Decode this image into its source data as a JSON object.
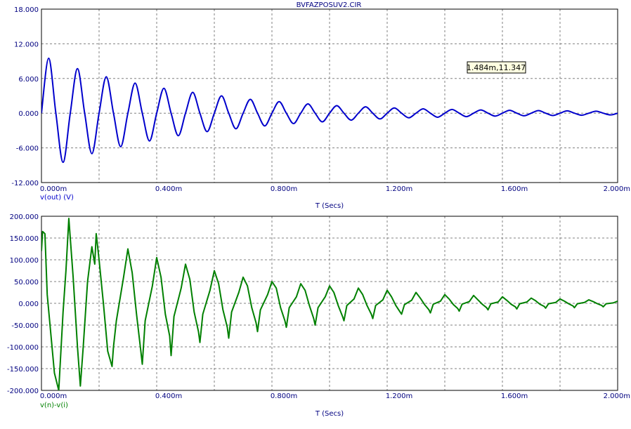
{
  "window": {
    "title": "BVFAZPOSUV2.CIR"
  },
  "colors": {
    "grid": "#808080",
    "frame": "#000000",
    "tick_text": "#000080",
    "top_trace": "#0000cc",
    "bottom_trace": "#008000",
    "tooltip_bg": "#ffffe1"
  },
  "tooltip": {
    "text": "1.484m,11.347",
    "x": 1.484,
    "y": 11.347
  },
  "chart_data": [
    {
      "type": "line",
      "trace_label": "v(out) (V)",
      "xlabel": "T (Secs)",
      "x_ticks": [
        "0.000m",
        "0.400m",
        "0.800m",
        "1.200m",
        "1.600m",
        "2.000m"
      ],
      "y_ticks": [
        "18.000",
        "12.000",
        "6.000",
        "0.000",
        "-6.000",
        "-12.000"
      ],
      "xlim": [
        0,
        2.0
      ],
      "ylim": [
        -12,
        18
      ],
      "series": [
        {
          "label": "v(out) (V)",
          "color": "#0000cc",
          "x": [
            0.0,
            0.025,
            0.05,
            0.075,
            0.1,
            0.125,
            0.15,
            0.175,
            0.2,
            0.225,
            0.25,
            0.275,
            0.3,
            0.325,
            0.35,
            0.375,
            0.4,
            0.425,
            0.45,
            0.475,
            0.5,
            0.525,
            0.55,
            0.575,
            0.6,
            0.625,
            0.65,
            0.675,
            0.7,
            0.725,
            0.75,
            0.775,
            0.8,
            0.825,
            0.85,
            0.875,
            0.9,
            0.925,
            0.95,
            0.975,
            1.0,
            1.025,
            1.05,
            1.075,
            1.1,
            1.125,
            1.15,
            1.175,
            1.2,
            1.225,
            1.25,
            1.275,
            1.3,
            1.325,
            1.35,
            1.375,
            1.4,
            1.425,
            1.45,
            1.475,
            1.5,
            1.525,
            1.55,
            1.575,
            1.6,
            1.625,
            1.65,
            1.675,
            1.7,
            1.725,
            1.75,
            1.775,
            1.8,
            1.825,
            1.85,
            1.875,
            1.9,
            1.925,
            1.95,
            1.975,
            2.0
          ],
          "y": [
            0.0,
            9.5,
            0.0,
            -8.5,
            0.0,
            7.7,
            0.0,
            -7.0,
            0.0,
            6.3,
            0.0,
            -5.8,
            0.0,
            5.2,
            0.0,
            -4.8,
            0.0,
            4.3,
            0.0,
            -3.9,
            0.0,
            3.6,
            0.0,
            -3.2,
            0.0,
            3.0,
            0.0,
            -2.7,
            0.0,
            2.4,
            0.0,
            -2.2,
            0.0,
            2.0,
            0.0,
            -1.8,
            0.0,
            1.6,
            0.0,
            -1.5,
            0.0,
            1.3,
            0.0,
            -1.2,
            0.0,
            1.1,
            0.0,
            -1.0,
            0.0,
            0.9,
            0.0,
            -0.8,
            0.0,
            0.75,
            0.0,
            -0.7,
            0.0,
            0.65,
            0.0,
            -0.6,
            0.0,
            0.55,
            0.0,
            -0.5,
            0.0,
            0.5,
            0.0,
            -0.45,
            0.0,
            0.45,
            0.0,
            -0.4,
            0.0,
            0.4,
            0.0,
            -0.35,
            0.0,
            0.35,
            0.0,
            -0.3,
            0.0
          ]
        }
      ]
    },
    {
      "type": "line",
      "trace_label": "v(n)-v(i)",
      "xlabel": "T (Secs)",
      "x_ticks": [
        "0.000m",
        "0.400m",
        "0.800m",
        "1.200m",
        "1.600m",
        "2.000m"
      ],
      "y_ticks": [
        "200.000",
        "150.000",
        "100.000",
        "50.000",
        "0.000",
        "-50.000",
        "-100.000",
        "-150.000",
        "-200.000"
      ],
      "xlim": [
        0,
        2.0
      ],
      "ylim": [
        -200,
        200
      ],
      "series": [
        {
          "label": "v(n)-v(i)",
          "color": "#008000",
          "x": [
            0.0,
            0.004,
            0.012,
            0.02,
            0.045,
            0.06,
            0.075,
            0.085,
            0.095,
            0.11,
            0.125,
            0.135,
            0.145,
            0.16,
            0.175,
            0.185,
            0.19,
            0.2,
            0.215,
            0.23,
            0.245,
            0.25,
            0.26,
            0.285,
            0.3,
            0.315,
            0.33,
            0.345,
            0.35,
            0.36,
            0.385,
            0.4,
            0.415,
            0.43,
            0.445,
            0.45,
            0.46,
            0.485,
            0.5,
            0.515,
            0.53,
            0.545,
            0.55,
            0.56,
            0.585,
            0.6,
            0.615,
            0.63,
            0.645,
            0.65,
            0.66,
            0.685,
            0.7,
            0.715,
            0.73,
            0.745,
            0.75,
            0.76,
            0.785,
            0.8,
            0.815,
            0.83,
            0.845,
            0.85,
            0.86,
            0.885,
            0.9,
            0.915,
            0.93,
            0.945,
            0.95,
            0.96,
            0.985,
            1.0,
            1.015,
            1.03,
            1.045,
            1.05,
            1.06,
            1.085,
            1.1,
            1.115,
            1.13,
            1.145,
            1.15,
            1.16,
            1.185,
            1.2,
            1.215,
            1.23,
            1.245,
            1.25,
            1.26,
            1.285,
            1.3,
            1.315,
            1.33,
            1.345,
            1.35,
            1.36,
            1.385,
            1.4,
            1.415,
            1.43,
            1.445,
            1.45,
            1.46,
            1.485,
            1.5,
            1.515,
            1.53,
            1.545,
            1.55,
            1.56,
            1.585,
            1.6,
            1.615,
            1.63,
            1.645,
            1.65,
            1.66,
            1.685,
            1.7,
            1.715,
            1.73,
            1.745,
            1.75,
            1.76,
            1.785,
            1.8,
            1.815,
            1.83,
            1.845,
            1.85,
            1.86,
            1.885,
            1.9,
            1.915,
            1.93,
            1.945,
            1.95,
            1.96,
            1.985,
            2.0
          ],
          "y": [
            120,
            165,
            160,
            20,
            -160,
            -200,
            -20,
            75,
            195,
            60,
            -100,
            -190,
            -100,
            50,
            130,
            90,
            160,
            100,
            0,
            -110,
            -145,
            -100,
            -40,
            60,
            125,
            70,
            -25,
            -110,
            -140,
            -40,
            40,
            105,
            60,
            -25,
            -75,
            -120,
            -30,
            35,
            90,
            55,
            -20,
            -65,
            -90,
            -25,
            30,
            75,
            45,
            -15,
            -55,
            -80,
            -20,
            25,
            60,
            40,
            -10,
            -45,
            -65,
            -15,
            20,
            50,
            35,
            -10,
            -40,
            -55,
            -10,
            15,
            45,
            30,
            -5,
            -35,
            -50,
            -10,
            15,
            40,
            25,
            -5,
            -30,
            -40,
            -5,
            10,
            35,
            20,
            -5,
            -25,
            -35,
            -5,
            8,
            30,
            15,
            -5,
            -20,
            -25,
            -3,
            7,
            25,
            12,
            -3,
            -15,
            -22,
            -2,
            5,
            20,
            10,
            -3,
            -12,
            -18,
            -2,
            4,
            18,
            8,
            -2,
            -10,
            -15,
            -1,
            3,
            15,
            7,
            -2,
            -8,
            -13,
            -1,
            3,
            12,
            6,
            -2,
            -7,
            -11,
            -1,
            2,
            10,
            5,
            -1,
            -6,
            -10,
            -1,
            2,
            8,
            4,
            -1,
            -5,
            -8,
            -1,
            1,
            5
          ]
        }
      ]
    }
  ]
}
